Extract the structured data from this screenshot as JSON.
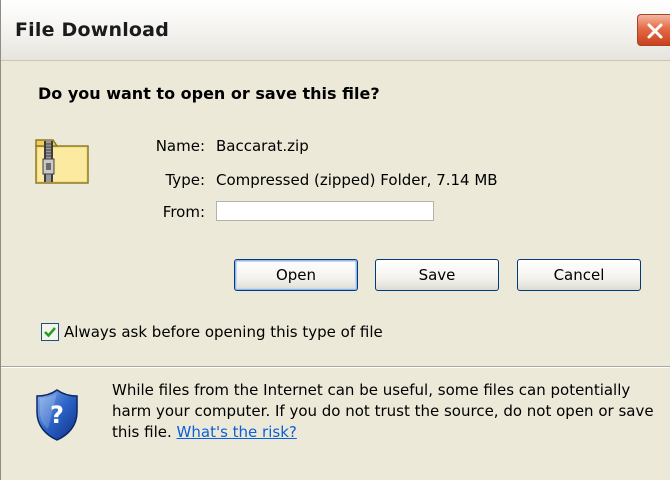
{
  "dialog": {
    "title": "File Download",
    "question": "Do you want to open or save this file?"
  },
  "file": {
    "name_label": "Name:",
    "name_value": "Baccarat.zip",
    "type_label": "Type:",
    "type_value": "Compressed (zipped) Folder, 7.14 MB",
    "from_label": "From:",
    "from_value": ""
  },
  "buttons": {
    "open": "Open",
    "save": "Save",
    "cancel": "Cancel"
  },
  "checkbox": {
    "label": "Always ask before opening this type of file",
    "checked": true
  },
  "warning": {
    "text": "While files from the Internet can be useful, some files can potentially harm your computer. If you do not trust the source, do not open or save this file.",
    "link": "What's the risk?"
  },
  "icons": {
    "close": "close-icon",
    "file": "zip-folder-icon",
    "shield": "shield-question-icon",
    "check": "checkmark-icon"
  },
  "colors": {
    "dialog_bg": "#ece9d8",
    "close_button": "#e56b45",
    "link": "#0b5fd8",
    "button_border": "#003c74"
  }
}
